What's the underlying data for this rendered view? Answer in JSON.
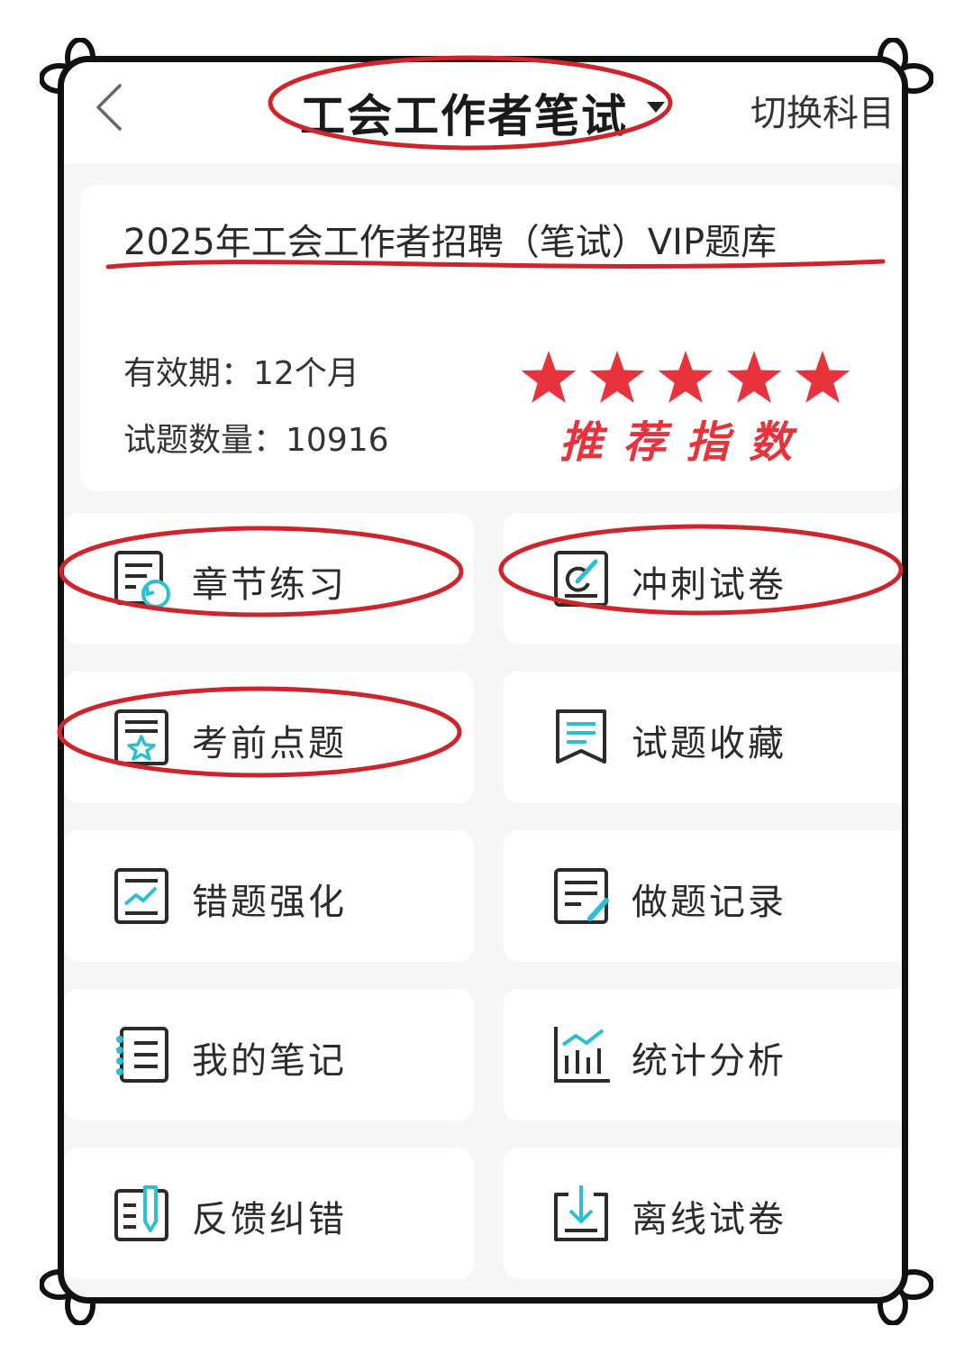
{
  "header": {
    "title": "工会工作者笔试",
    "switch_label": "切换科目"
  },
  "package": {
    "title": "2025年工会工作者招聘（笔试）VIP题库",
    "validity_label": "有效期：",
    "validity_value": "12个月",
    "count_label": "试题数量：",
    "count_value": "10916",
    "rating_stars": 5,
    "rating_max": 5,
    "rating_label": "推荐指数",
    "accent_color": "#e8323c"
  },
  "menu": [
    {
      "label": "章节练习",
      "icon": "chapter-practice-icon"
    },
    {
      "label": "冲刺试卷",
      "icon": "sprint-paper-icon"
    },
    {
      "label": "考前点题",
      "icon": "pre-exam-tips-icon"
    },
    {
      "label": "试题收藏",
      "icon": "bookmark-icon"
    },
    {
      "label": "错题强化",
      "icon": "wrong-answers-icon"
    },
    {
      "label": "做题记录",
      "icon": "practice-record-icon"
    },
    {
      "label": "我的笔记",
      "icon": "notes-icon"
    },
    {
      "label": "统计分析",
      "icon": "statistics-icon"
    },
    {
      "label": "反馈纠错",
      "icon": "feedback-icon"
    },
    {
      "label": "离线试卷",
      "icon": "download-icon"
    }
  ],
  "colors": {
    "icon_dark": "#2b2b2b",
    "icon_accent": "#2bbfd4",
    "highlight_red": "#d0242c"
  }
}
